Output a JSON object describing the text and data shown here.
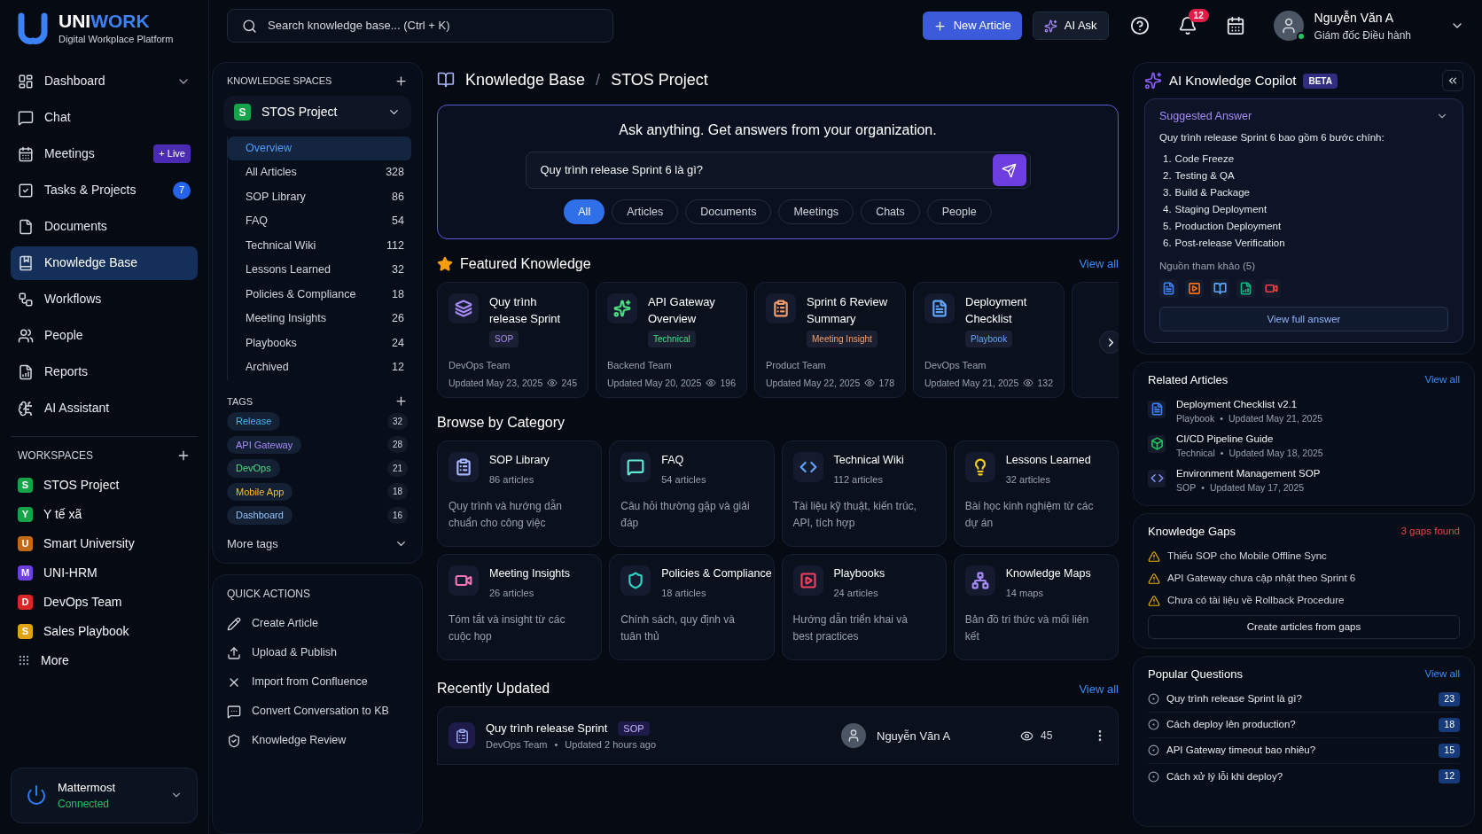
{
  "brand": {
    "name": [
      "UNI",
      "WORK"
    ],
    "tagline": "Digital Workplace Platform"
  },
  "topbar": {
    "search_placeholder": "Search knowledge base... (Ctrl + K)",
    "new_button": "New Article",
    "ai_button": "AI Ask",
    "notifications": "12",
    "user": {
      "name": "Nguyễn Văn A",
      "role": "Giám đốc Điều hành",
      "online": true
    }
  },
  "nav": [
    {
      "label": "Dashboard",
      "selected": false,
      "expandable": true
    },
    {
      "label": "Chat",
      "selected": false,
      "expandable": false
    },
    {
      "label": "Meetings",
      "selected": false,
      "expandable": false,
      "badge": {
        "kind": "live",
        "text": "+ Live"
      }
    },
    {
      "label": "Tasks & Projects",
      "selected": false,
      "expandable": false,
      "badge": {
        "kind": "count",
        "text": "7"
      }
    },
    {
      "label": "Documents",
      "selected": false,
      "expandable": false
    },
    {
      "label": "Knowledge Base",
      "selected": true,
      "expandable": false
    },
    {
      "label": "Workflows",
      "selected": false,
      "expandable": false
    },
    {
      "label": "People",
      "selected": false,
      "expandable": false
    },
    {
      "label": "Reports",
      "selected": false,
      "expandable": false
    },
    {
      "label": "AI Assistant",
      "selected": false,
      "expandable": false
    }
  ],
  "workspaces": {
    "title": "WORKSPACES",
    "items": [
      {
        "letter": "S",
        "name": "STOS Project",
        "color": "#16a34a"
      },
      {
        "letter": "Y",
        "name": "Y tế xã",
        "color": "#16a34a"
      },
      {
        "letter": "U",
        "name": "Smart University",
        "color": "#c26a1a"
      },
      {
        "letter": "M",
        "name": "UNI-HRM",
        "color": "#6d3fe0"
      },
      {
        "letter": "D",
        "name": "DevOps Team",
        "color": "#dc2626"
      },
      {
        "letter": "S",
        "name": "Sales Playbook",
        "color": "#e0a412"
      }
    ],
    "more": "More"
  },
  "integration": {
    "name": "Mattermost",
    "status": "Connected"
  },
  "spaces": {
    "title": "KNOWLEDGE SPACES",
    "current": {
      "letter": "S",
      "name": "STOS Project",
      "color": "#16a34a"
    },
    "items": [
      {
        "label": "Overview",
        "selected": true
      },
      {
        "label": "All Articles",
        "count": "328",
        "selected": false
      },
      {
        "label": "SOP Library",
        "count": "86",
        "selected": false
      },
      {
        "label": "FAQ",
        "count": "54",
        "selected": false
      },
      {
        "label": "Technical Wiki",
        "count": "112",
        "selected": false
      },
      {
        "label": "Lessons Learned",
        "count": "32",
        "selected": false
      },
      {
        "label": "Policies & Compliance",
        "count": "18",
        "selected": false
      },
      {
        "label": "Meeting Insights",
        "count": "26",
        "selected": false
      },
      {
        "label": "Playbooks",
        "count": "24",
        "selected": false
      },
      {
        "label": "Archived",
        "count": "12",
        "selected": false
      }
    ]
  },
  "tags": {
    "title": "TAGS",
    "items": [
      {
        "label": "Release",
        "count": "32",
        "color": "#38bdf8"
      },
      {
        "label": "API Gateway",
        "count": "28",
        "color": "#a78bfa"
      },
      {
        "label": "DevOps",
        "count": "21",
        "color": "#4ade80"
      },
      {
        "label": "Mobile App",
        "count": "18",
        "color": "#fbbf24"
      },
      {
        "label": "Dashboard",
        "count": "16",
        "color": "#93c5fd"
      }
    ],
    "more": "More tags"
  },
  "quick_actions": {
    "title": "QUICK ACTIONS",
    "items": [
      "Create Article",
      "Upload & Publish",
      "Import from Confluence",
      "Convert Conversation to KB",
      "Knowledge Review"
    ]
  },
  "breadcrumb": {
    "separator": "/",
    "items": [
      "Knowledge Base",
      "STOS Project"
    ]
  },
  "ask": {
    "heading": "Ask anything. Get answers from your organization.",
    "query": "Quy trình release Sprint 6 là gì?",
    "filters": [
      {
        "label": "All",
        "selected": true
      },
      {
        "label": "Articles",
        "selected": false
      },
      {
        "label": "Documents",
        "selected": false
      },
      {
        "label": "Meetings",
        "selected": false
      },
      {
        "label": "Chats",
        "selected": false
      },
      {
        "label": "People",
        "selected": false
      }
    ]
  },
  "featured": {
    "title": "Featured Knowledge",
    "view_all": "View all",
    "cards": [
      {
        "title": "Quy trình release Sprint",
        "tag": "SOP",
        "team": "DevOps Team",
        "updated": "Updated May 23, 2025",
        "views": "245",
        "color": "#a78bfa"
      },
      {
        "title": "API Gateway Overview",
        "tag": "Technical",
        "team": "Backend Team",
        "updated": "Updated May 20, 2025",
        "views": "196",
        "color": "#4ade80"
      },
      {
        "title": "Sprint 6 Review Summary",
        "tag": "Meeting Insight",
        "team": "Product Team",
        "updated": "Updated May 22, 2025",
        "views": "178",
        "color": "#f59e6b"
      },
      {
        "title": "Deployment Checklist",
        "tag": "Playbook",
        "team": "DevOps Team",
        "updated": "Updated May 21, 2025",
        "views": "132",
        "color": "#60a5fa"
      }
    ]
  },
  "categories": {
    "title": "Browse by Category",
    "items": [
      {
        "title": "SOP Library",
        "count": "86 articles",
        "desc": "Quy trình và hướng dẫn chuẩn cho công việc",
        "color": "#a5b4fc"
      },
      {
        "title": "FAQ",
        "count": "54 articles",
        "desc": "Câu hỏi thường gặp và giải đáp",
        "color": "#5eead4"
      },
      {
        "title": "Technical Wiki",
        "count": "112 articles",
        "desc": "Tài liệu kỹ thuật, kiến trúc, API, tích hợp",
        "color": "#60a5fa"
      },
      {
        "title": "Lessons Learned",
        "count": "32 articles",
        "desc": "Bài học kinh nghiệm từ các dự án",
        "color": "#facc15"
      },
      {
        "title": "Meeting Insights",
        "count": "26 articles",
        "desc": "Tóm tắt và insight từ các cuộc họp",
        "color": "#f472b6"
      },
      {
        "title": "Policies & Compliance",
        "count": "18 articles",
        "desc": "Chính sách, quy định và tuân thủ",
        "color": "#2dd4bf"
      },
      {
        "title": "Playbooks",
        "count": "24 articles",
        "desc": "Hướng dẫn triển khai và best practices",
        "color": "#f43f5e"
      },
      {
        "title": "Knowledge Maps",
        "count": "14 maps",
        "desc": "Bản đồ tri thức và mối liên kết",
        "color": "#a78bfa"
      }
    ]
  },
  "recent": {
    "title": "Recently Updated",
    "view_all": "View all",
    "rows": [
      {
        "title": "Quy trình release Sprint",
        "tag": "SOP",
        "team": "DevOps Team",
        "updated": "Updated 2 hours ago",
        "dot": "•",
        "author": "Nguyễn Văn A",
        "views": "45"
      }
    ]
  },
  "copilot": {
    "title": "AI Knowledge Copilot",
    "badge": "BETA",
    "answer": {
      "title": "Suggested Answer",
      "intro": "Quy trình release Sprint 6 bao gồm 6 bước chính:",
      "steps": [
        {
          "n": "1.",
          "text": "Code Freeze"
        },
        {
          "n": "2.",
          "text": "Testing & QA"
        },
        {
          "n": "3.",
          "text": "Build & Package"
        },
        {
          "n": "4.",
          "text": "Staging Deployment"
        },
        {
          "n": "5.",
          "text": "Production Deployment"
        },
        {
          "n": "6.",
          "text": "Post-release Verification"
        }
      ],
      "sources_label": "Nguồn tham khảo (5)",
      "sources": [
        {
          "color": "#3b82f6"
        },
        {
          "color": "#f97316"
        },
        {
          "color": "#60a5fa"
        },
        {
          "color": "#10b981"
        },
        {
          "color": "#ef4444"
        }
      ],
      "button": "View full answer"
    }
  },
  "related": {
    "title": "Related Articles",
    "view_all": "View all",
    "items": [
      {
        "title": "Deployment Checklist v2.1",
        "type": "Playbook",
        "dot": "•",
        "updated": "Updated May 21, 2025",
        "color": "#3b82f6"
      },
      {
        "title": "CI/CD Pipeline Guide",
        "type": "Technical",
        "dot": "•",
        "updated": "Updated May 18, 2025",
        "color": "#22c55e"
      },
      {
        "title": "Environment Management SOP",
        "type": "SOP",
        "dot": "•",
        "updated": "Updated May 17, 2025",
        "color": "#818cf8"
      }
    ]
  },
  "gaps": {
    "title": "Knowledge Gaps",
    "count": "3 gaps found",
    "items": [
      "Thiếu SOP cho Mobile Offline Sync",
      "API Gateway chưa cập nhật theo Sprint 6",
      "Chưa có tài liệu về Rollback Procedure"
    ],
    "button": "Create articles from gaps"
  },
  "questions": {
    "title": "Popular Questions",
    "view_all": "View all",
    "items": [
      {
        "text": "Quy trình release Sprint là gì?",
        "count": "23"
      },
      {
        "text": "Cách deploy lên production?",
        "count": "18"
      },
      {
        "text": "API Gateway timeout bao nhiêu?",
        "count": "15"
      },
      {
        "text": "Cách xử lý lỗi khi deploy?",
        "count": "12"
      }
    ]
  }
}
